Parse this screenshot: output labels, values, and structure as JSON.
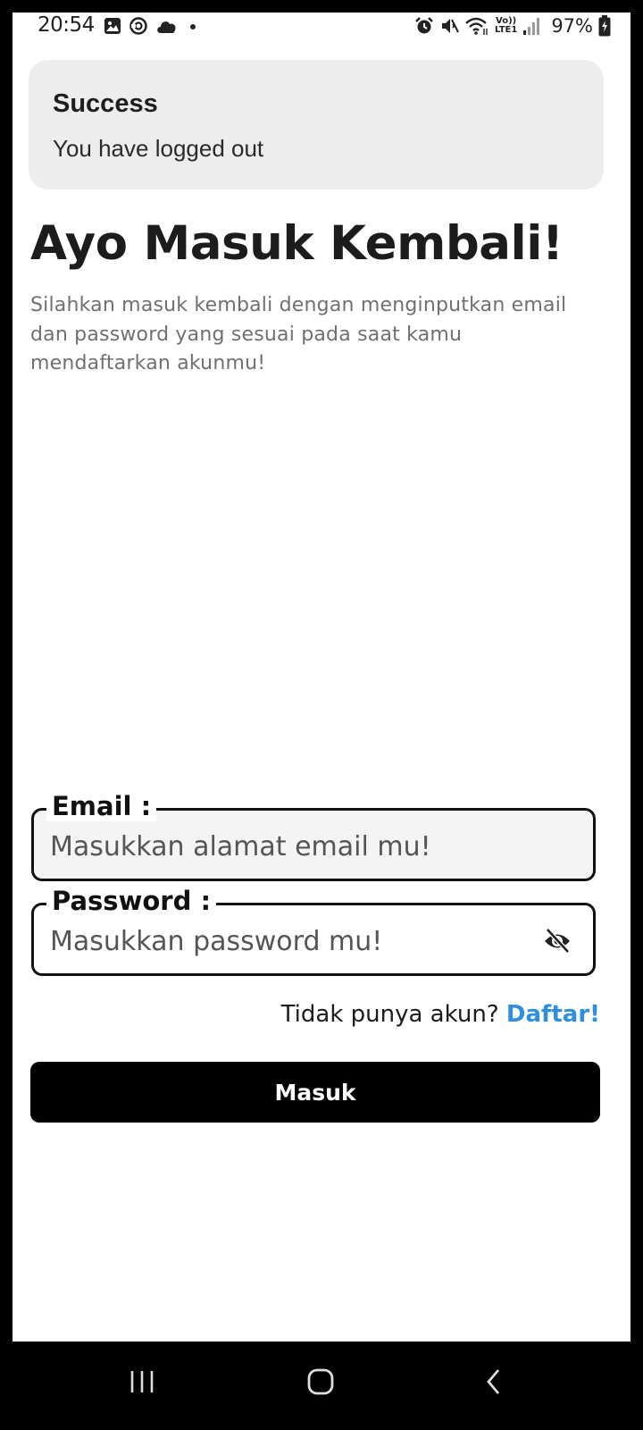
{
  "status_bar": {
    "time": "20:54",
    "network": "LTE1",
    "network_top": "Vo))",
    "battery": "97%",
    "left_icons": [
      "gallery-icon",
      "sync-icon",
      "cloud-icon",
      "dot-icon"
    ],
    "right_icons": [
      "alarm-icon",
      "mute-icon",
      "wifi-icon",
      "signal-icon",
      "battery-charging-icon"
    ]
  },
  "toast": {
    "title": "Success",
    "message": "You have logged out"
  },
  "login": {
    "title": "Ayo Masuk Kembali!",
    "subtitle": "Silahkan masuk kembali dengan menginputkan email dan password yang sesuai pada saat kamu mendaftarkan akunmu!",
    "email_label": "Email :",
    "email_placeholder": "Masukkan alamat email mu!",
    "password_label": "Password :",
    "password_placeholder": "Masukkan password mu!",
    "no_account_text": "Tidak punya akun?",
    "register_link": "Daftar!",
    "submit_label": "Masuk"
  },
  "colors": {
    "link": "#2f8fdd",
    "button": "#000000",
    "toast_bg": "#ededed"
  },
  "nav_bar": {
    "buttons": [
      "recents-icon",
      "home-icon",
      "back-icon"
    ]
  }
}
